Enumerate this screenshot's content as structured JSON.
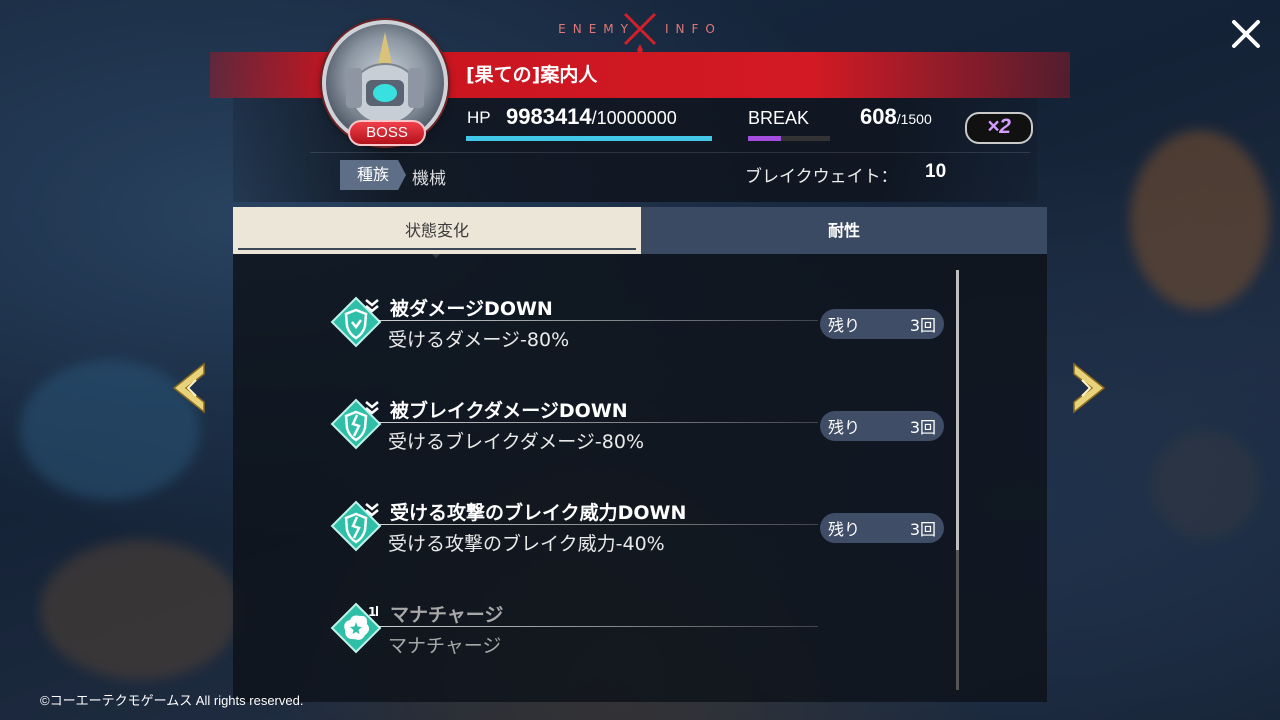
{
  "header": {
    "title_left": "ENEMY",
    "title_right": "INFO",
    "close_icon": "close-icon"
  },
  "enemy": {
    "name": "[果ての]案内人",
    "badge": "BOSS",
    "hp_label": "HP",
    "hp_current": "9983414",
    "hp_max": "/10000000",
    "hp_fraction": 0.998,
    "break_label": "BREAK",
    "break_current": "608",
    "break_max": "/1500",
    "break_fraction": 0.405,
    "multiplier": "×2",
    "race_label": "種族",
    "race_value": "機械",
    "break_weight_label": "ブレイクウェイト：",
    "break_weight_value": "10"
  },
  "tabs": [
    {
      "label": "状態変化",
      "active": true
    },
    {
      "label": "耐性",
      "active": false
    }
  ],
  "effects": [
    {
      "title": "被ダメージDOWN",
      "desc": "受けるダメージ-80%",
      "remain_label": "残り",
      "remain_value": "3回",
      "icon": "shield-down-icon"
    },
    {
      "title": "被ブレイクダメージDOWN",
      "desc": "受けるブレイクダメージ-80%",
      "remain_label": "残り",
      "remain_value": "3回",
      "icon": "broken-shield-down-icon"
    },
    {
      "title": "受ける攻撃のブレイク威力DOWN",
      "desc": "受ける攻撃のブレイク威力-40%",
      "remain_label": "残り",
      "remain_value": "3回",
      "icon": "broken-shield-down-icon"
    },
    {
      "title": "マナチャージ",
      "desc": "マナチャージ",
      "icon": "mana-charge-icon"
    }
  ],
  "nav": {
    "prev_icon": "chevron-left-icon",
    "next_icon": "chevron-right-icon"
  },
  "footer": {
    "copyright": "©コーエーテクモゲームス All rights reserved."
  },
  "colors": {
    "header_red": "#d31a24",
    "hp_bar": "#42c7e8",
    "break_bar": "#a44ddf",
    "effect_icon": "#2fbfa8",
    "tab_active": "#ece6d9",
    "tab_inactive": "#3b4a63"
  }
}
